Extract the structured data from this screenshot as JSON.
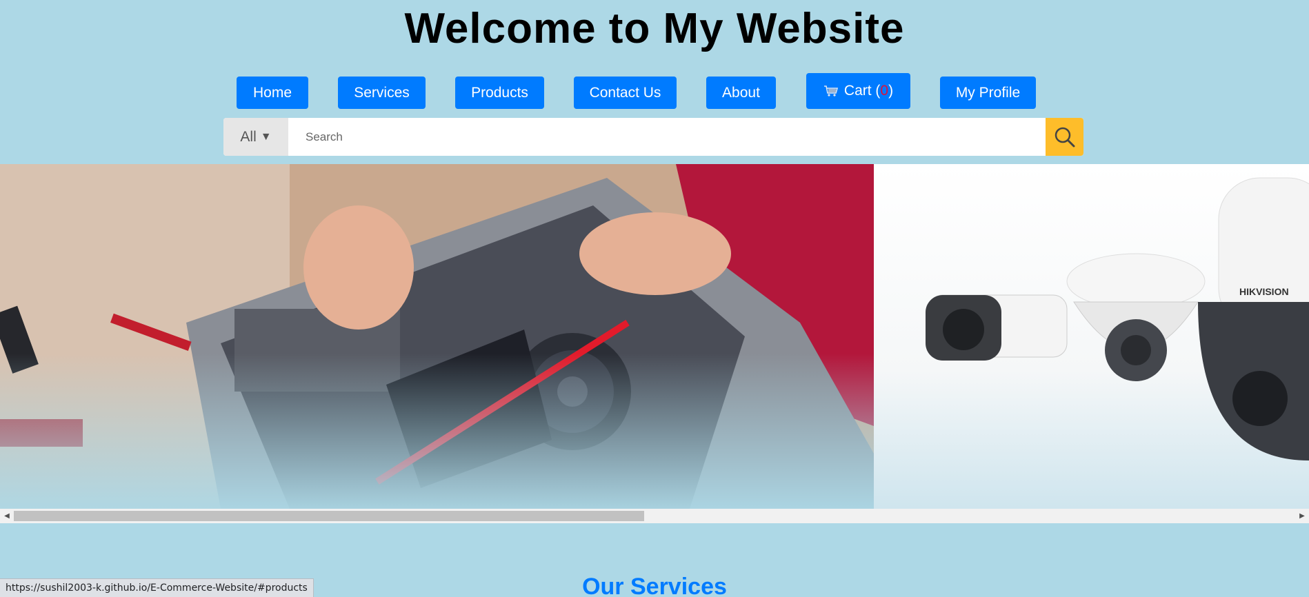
{
  "header": {
    "title": "Welcome to My Website"
  },
  "nav": {
    "items": [
      {
        "label": "Home"
      },
      {
        "label": "Services"
      },
      {
        "label": "Products"
      },
      {
        "label": "Contact Us"
      },
      {
        "label": "About"
      },
      {
        "label": "Cart (",
        "count": "0",
        "suffix": ")",
        "icon": "cart-icon"
      },
      {
        "label": "My Profile"
      }
    ]
  },
  "search": {
    "category": "All",
    "placeholder": "Search",
    "button_icon": "search-icon"
  },
  "carousel": {
    "slides": [
      {
        "content": "computer repair image"
      },
      {
        "content": "security cameras image",
        "brand": "HIKVISION"
      }
    ]
  },
  "sections": {
    "services_title": "Our Services"
  },
  "status_bar": {
    "url": "https://sushil2003-k.github.io/E-Commerce-Website/#products"
  },
  "colors": {
    "background": "#add8e6",
    "nav_button": "#007bff",
    "search_button": "#febd2a",
    "cart_count": "#dc143c"
  }
}
